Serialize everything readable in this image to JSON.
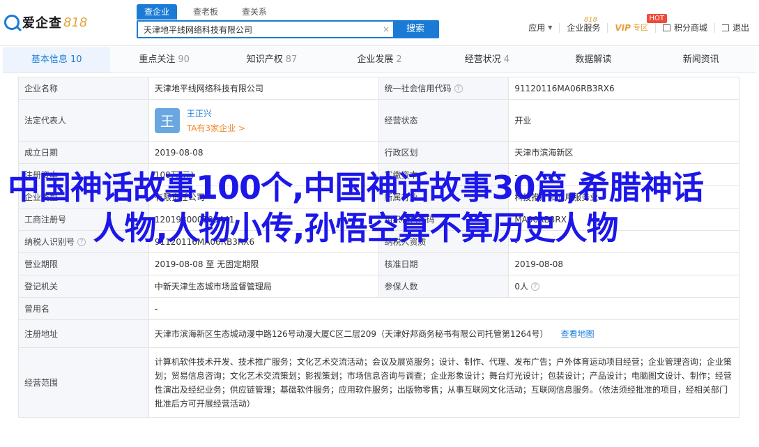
{
  "logo": {
    "text": "爱企查",
    "badge": "818"
  },
  "search": {
    "tabs": [
      "查企业",
      "查老板",
      "查关系"
    ],
    "value": "天津地平线网络科技有限公司",
    "clear": "×",
    "button": "搜索"
  },
  "topnav": {
    "apply": "应用",
    "enterprise_service": "企业服务",
    "vip": "VIP",
    "vip_zone": "专区",
    "vip818": "818",
    "hot": "HOT",
    "points_mall": "积分商城",
    "logout": "退出"
  },
  "tabs": [
    {
      "label": "基本信息",
      "count": "10"
    },
    {
      "label": "重点关注",
      "count": "90"
    },
    {
      "label": "知识产权",
      "count": "87"
    },
    {
      "label": "企业发展",
      "count": "2"
    },
    {
      "label": "经营状况",
      "count": "4"
    },
    {
      "label": "数据解读",
      "count": ""
    },
    {
      "label": "新闻资讯",
      "count": ""
    }
  ],
  "info": {
    "r1": {
      "l1": "企业名称",
      "v1": "天津地平线网络科技有限公司",
      "l2": "统一社会信用代码",
      "v2": "91120116MA06RB3RX6"
    },
    "r2": {
      "l1": "法定代表人",
      "avatar": "王",
      "person": "王正兴",
      "person_sub": "TA有3家企业 >",
      "l2": "经营状态",
      "v2": "开业"
    },
    "r3": {
      "l1": "成立日期",
      "v1": "2019-08-08",
      "l2": "行政区划",
      "v2": "天津市滨海新区"
    },
    "r4": {
      "l1": "注册资本",
      "v1": "100万(元)",
      "l2": "实缴资本",
      "v2": "-"
    },
    "r5": {
      "l1": "企业类型",
      "v1": "有限责任公司",
      "l2": "所属行业",
      "v2": "科技推广和应用服务业"
    },
    "r6": {
      "l1": "工商注册号",
      "v1": "120193000100441",
      "l2": "组织机构代码",
      "v2": "MA06RB3RX"
    },
    "r7": {
      "l1": "纳税人识别号",
      "v1": "91120116MA06RB3RX6",
      "l2": "纳税人资质",
      "v2": "-"
    },
    "r8": {
      "l1": "营业期限",
      "v1": "2019-08-08 至 无固定期限",
      "l2": "核准日期",
      "v2": "2019-08-08"
    },
    "r9": {
      "l1": "登记机关",
      "v1": "中新天津生态城市场监督管理局",
      "l2": "参保人数",
      "v2": "0人"
    },
    "r10": {
      "l1": "曾用名",
      "v1": "-"
    },
    "r11": {
      "l1": "注册地址",
      "v1": "天津市滨海新区生态城动漫中路126号动漫大厦C区二层209（天津好邦商务秘书有限公司托管第1264号）",
      "link": "查看地图"
    },
    "r12": {
      "l1": "经营范围",
      "v1": "计算机软件技术开发、技术推广服务；文化艺术交流活动；会议及展览服务；设计、制作、代理、发布广告；户外体育运动项目经营；企业管理咨询；企业策划；贸易信息咨询；文化艺术交流策划；影视策划；市场信息咨询与调查；企业形象设计；舞台灯光设计；包装设计；产品设计；电脑图文设计、制作；经营性演出及经纪业务；供应链管理；基础软件服务；应用软件服务；出版物零售；从事互联网文化活动；互联网信息服务。（依法须经批准的项目，经相关部门批准后方可开展经营活动）"
    }
  },
  "overlay": "中国神话故事100个,中国神话故事30篇,希腊神话人物,人物小传,孙悟空算不算历史人物"
}
